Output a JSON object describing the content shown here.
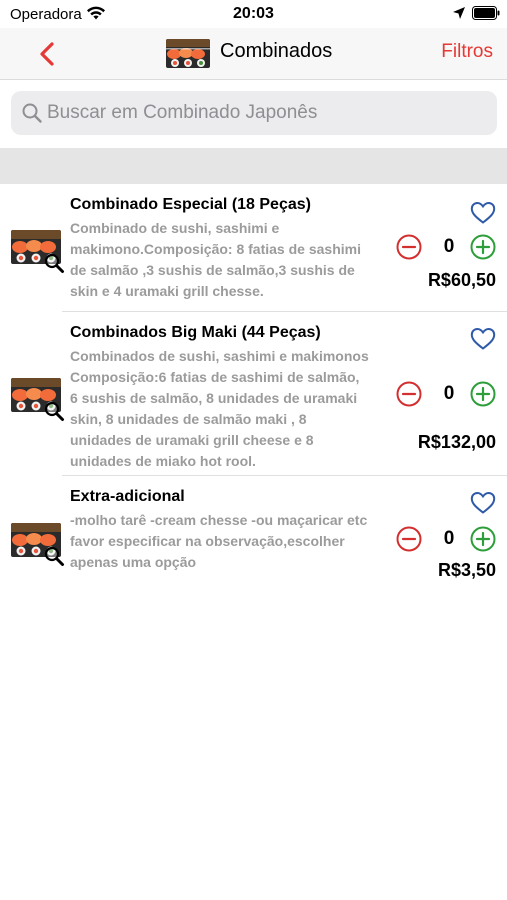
{
  "status_bar": {
    "carrier": "Operadora",
    "time": "20:03"
  },
  "nav": {
    "title": "Combinados",
    "filter_label": "Filtros",
    "back_icon": "chevron-left",
    "accent": "#e53935"
  },
  "search": {
    "placeholder": "Buscar em Combinado Japonês",
    "value": ""
  },
  "products": [
    {
      "title": "Combinado Especial (18 Peças)",
      "description": "Combinado de sushi, sashimi e makimono.Composição: 8 fatias de sashimi de salmão ,3 sushis de salmão,3 sushis de skin e 4 uramaki grill chesse.",
      "quantity": "0",
      "price": "R$60,50"
    },
    {
      "title": "Combinados Big Maki (44 Peças)",
      "description": "Combinados de sushi, sashimi e makimonos Composição:6 fatias de sashimi de salmão, 6 sushis de salmão, 8 unidades de uramaki skin, 8 unidades de salmão maki , 8 unidades de uramaki grill cheese e 8 unidades de miako hot rool.",
      "quantity": "0",
      "price": "R$132,00"
    },
    {
      "title": "Extra-adicional",
      "description": "-molho tarê -cream chesse -ou maçaricar etc favor especificar na observação,escolher apenas uma opção",
      "quantity": "0",
      "price": "R$3,50"
    }
  ],
  "colors": {
    "minus": "#d32f2f",
    "plus": "#2e9e3a",
    "heart": "#2f5aa8",
    "description": "#9b9b9b"
  }
}
